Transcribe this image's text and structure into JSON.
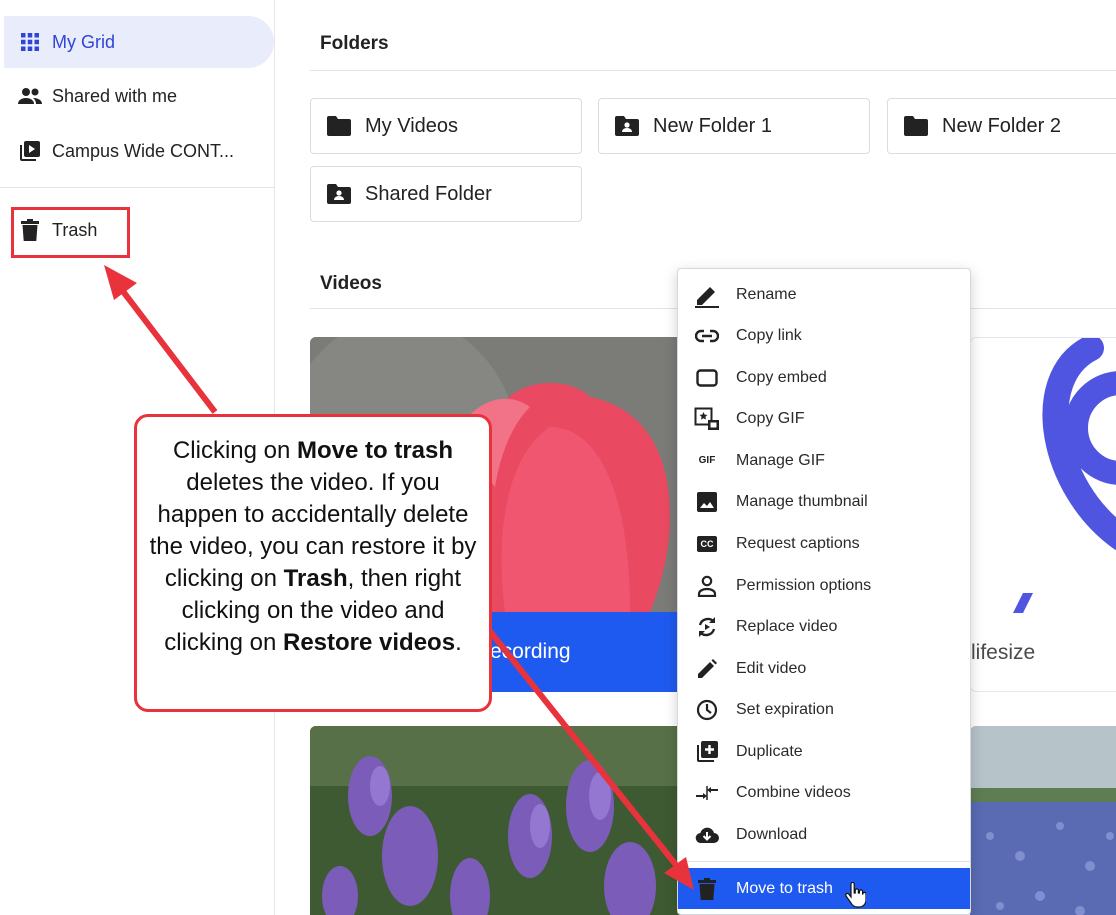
{
  "sidebar": {
    "items": [
      {
        "label": "My Grid",
        "icon": "grid-icon",
        "active": true
      },
      {
        "label": "Shared with me",
        "icon": "people-icon"
      },
      {
        "label": "Campus Wide CONT...",
        "icon": "video-library-icon"
      }
    ],
    "trash": {
      "label": "Trash",
      "icon": "trash-icon"
    }
  },
  "folders": {
    "title": "Folders",
    "items": [
      {
        "label": "My Videos",
        "icon": "folder-icon"
      },
      {
        "label": "New Folder 1",
        "icon": "shared-folder-icon"
      },
      {
        "label": "New Folder 2",
        "icon": "folder-icon"
      },
      {
        "label": "Shared Folder",
        "icon": "shared-folder-icon"
      }
    ]
  },
  "videos": {
    "title": "Videos",
    "cards": [
      {
        "title_partial": "ecording",
        "bar_color": "#1f5af0"
      },
      {
        "title_partial": "lifesize"
      }
    ]
  },
  "context_menu": {
    "items": [
      {
        "label": "Rename",
        "icon": "pencil-icon"
      },
      {
        "label": "Copy link",
        "icon": "link-icon"
      },
      {
        "label": "Copy embed",
        "icon": "embed-icon"
      },
      {
        "label": "Copy GIF",
        "icon": "gif-copy-icon"
      },
      {
        "label": "Manage GIF",
        "icon": "gif-icon",
        "icon_text": "GIF"
      },
      {
        "label": "Manage thumbnail",
        "icon": "image-icon"
      },
      {
        "label": "Request captions",
        "icon": "closed-caption-icon",
        "icon_text": "CC"
      },
      {
        "label": "Permission options",
        "icon": "person-icon"
      },
      {
        "label": "Replace video",
        "icon": "replace-icon"
      },
      {
        "label": "Edit video",
        "icon": "edit-icon"
      },
      {
        "label": "Set expiration",
        "icon": "clock-icon"
      },
      {
        "label": "Duplicate",
        "icon": "duplicate-icon"
      },
      {
        "label": "Combine videos",
        "icon": "combine-icon"
      },
      {
        "label": "Download",
        "icon": "download-cloud-icon"
      },
      {
        "label": "Move to trash",
        "icon": "trash-icon",
        "highlighted": true
      }
    ]
  },
  "annotation": {
    "t1": "Clicking on ",
    "b1": "Move to trash",
    "t2": " deletes the video. If you happen to accidentally delete the video, you can restore it by clicking on ",
    "b2": "Trash",
    "t3": ", then right clicking on the video and clicking on ",
    "b3": "Restore videos",
    "t4": "."
  },
  "colors": {
    "accent": "#1f5af0",
    "active_nav_bg": "#e8ecfb",
    "active_nav_text": "#2f45d6",
    "annotation_red": "#e8333c"
  }
}
